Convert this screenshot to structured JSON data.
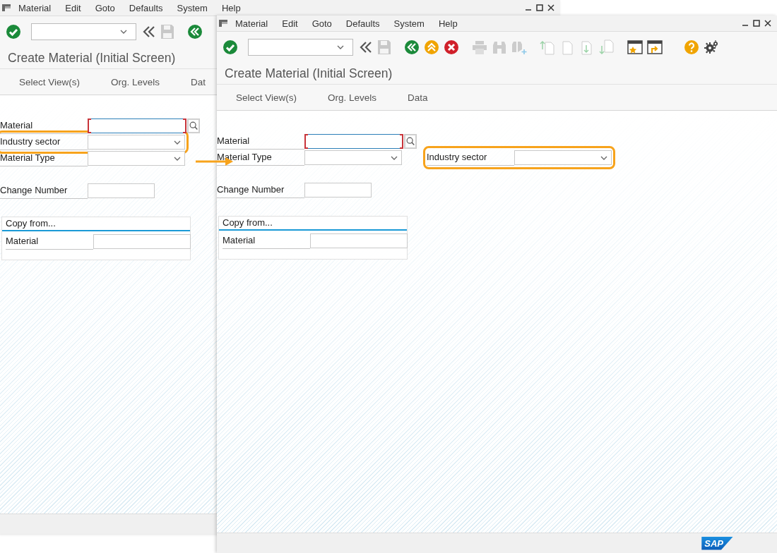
{
  "windows": [
    {
      "menu": [
        "Material",
        "Edit",
        "Goto",
        "Defaults",
        "System",
        "Help"
      ],
      "title": "Create Material (Initial Screen)",
      "tabs": [
        "Select View(s)",
        "Org. Levels",
        "Dat"
      ],
      "fields": [
        {
          "label": "Material",
          "kind": "search",
          "required": true,
          "focused": true,
          "highlighted": false,
          "aside": false
        },
        {
          "label": "Industry sector",
          "kind": "dropdown",
          "required": false,
          "focused": false,
          "highlighted": true,
          "aside": false
        },
        {
          "label": "Material Type",
          "kind": "dropdown",
          "required": false,
          "focused": false,
          "highlighted": false,
          "aside": false
        }
      ],
      "extra_fields": [
        {
          "label": "Change Number",
          "kind": "text",
          "required": false,
          "focused": false
        }
      ],
      "copy_from": {
        "title": "Copy from...",
        "fields": [
          {
            "label": "Material",
            "kind": "text",
            "required": false,
            "focused": false
          }
        ]
      }
    },
    {
      "menu": [
        "Material",
        "Edit",
        "Goto",
        "Defaults",
        "System",
        "Help"
      ],
      "title": "Create Material (Initial Screen)",
      "tabs": [
        "Select View(s)",
        "Org. Levels",
        "Data"
      ],
      "fields": [
        {
          "label": "Material",
          "kind": "search",
          "required": true,
          "focused": true,
          "highlighted": false,
          "aside": false
        },
        {
          "label": "Industry sector",
          "kind": "dropdown",
          "required": false,
          "focused": false,
          "highlighted": true,
          "aside": true
        },
        {
          "label": "Material Type",
          "kind": "dropdown",
          "required": false,
          "focused": false,
          "highlighted": false,
          "aside": false
        }
      ],
      "extra_fields": [
        {
          "label": "Change Number",
          "kind": "text",
          "required": false,
          "focused": false
        }
      ],
      "copy_from": {
        "title": "Copy from...",
        "fields": [
          {
            "label": "Material",
            "kind": "text",
            "required": false,
            "focused": false
          }
        ]
      },
      "logo": "SAP"
    }
  ]
}
